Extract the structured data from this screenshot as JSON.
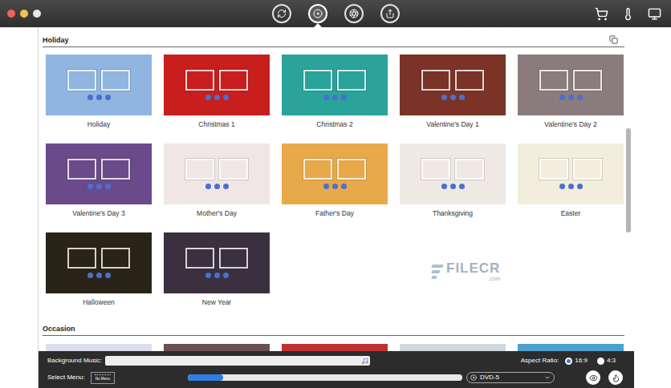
{
  "toolbar": {
    "tabs": [
      {
        "kind": "convert",
        "selected": false
      },
      {
        "kind": "burn",
        "selected": true
      },
      {
        "kind": "toolbox",
        "selected": false
      },
      {
        "kind": "share",
        "selected": false
      }
    ],
    "actions": [
      {
        "kind": "cart"
      },
      {
        "kind": "temperature"
      },
      {
        "kind": "screen"
      }
    ]
  },
  "sections": [
    {
      "title": "Holiday",
      "templates": [
        {
          "label": "Holiday",
          "color": "#8fb5e0"
        },
        {
          "label": "Christmas 1",
          "color": "#c81e1e"
        },
        {
          "label": "Christmas 2",
          "color": "#2aa39b"
        },
        {
          "label": "Valentine's Day 1",
          "color": "#7a3326"
        },
        {
          "label": "Valentine's Day 2",
          "color": "#8a7c7c"
        },
        {
          "label": "Valentine's Day 3",
          "color": "#6a4a8a"
        },
        {
          "label": "Mother's Day",
          "color": "#f0e6e6"
        },
        {
          "label": "Father's Day",
          "color": "#e8a94a"
        },
        {
          "label": "Thanksgiving",
          "color": "#efe9e4"
        },
        {
          "label": "Easter",
          "color": "#f2eddc"
        },
        {
          "label": "Halloween",
          "color": "#2a2418"
        },
        {
          "label": "New Year",
          "color": "#3a3040"
        }
      ]
    },
    {
      "title": "Occasion",
      "templates": [
        {
          "color": "#dcdcf0"
        },
        {
          "color": "#6a5050"
        },
        {
          "color": "#c03030"
        },
        {
          "color": "#d0d8e0"
        },
        {
          "color": "#4aa0d0"
        }
      ]
    }
  ],
  "bottom_bar": {
    "background_music": {
      "label": "Background Music:"
    },
    "aspect_ratio": {
      "label": "Aspect Ratio:",
      "options": [
        {
          "label": "16:9",
          "selected": true
        },
        {
          "label": "4:3",
          "selected": false
        }
      ]
    },
    "select_menu": {
      "label": "Select Menu:",
      "thumbnail": "No Menu"
    },
    "progress": {
      "level": 0.13
    },
    "disc_type": {
      "value": "DVD-5"
    }
  },
  "watermark": {
    "text": "FILECR",
    "subtext": ".com"
  }
}
